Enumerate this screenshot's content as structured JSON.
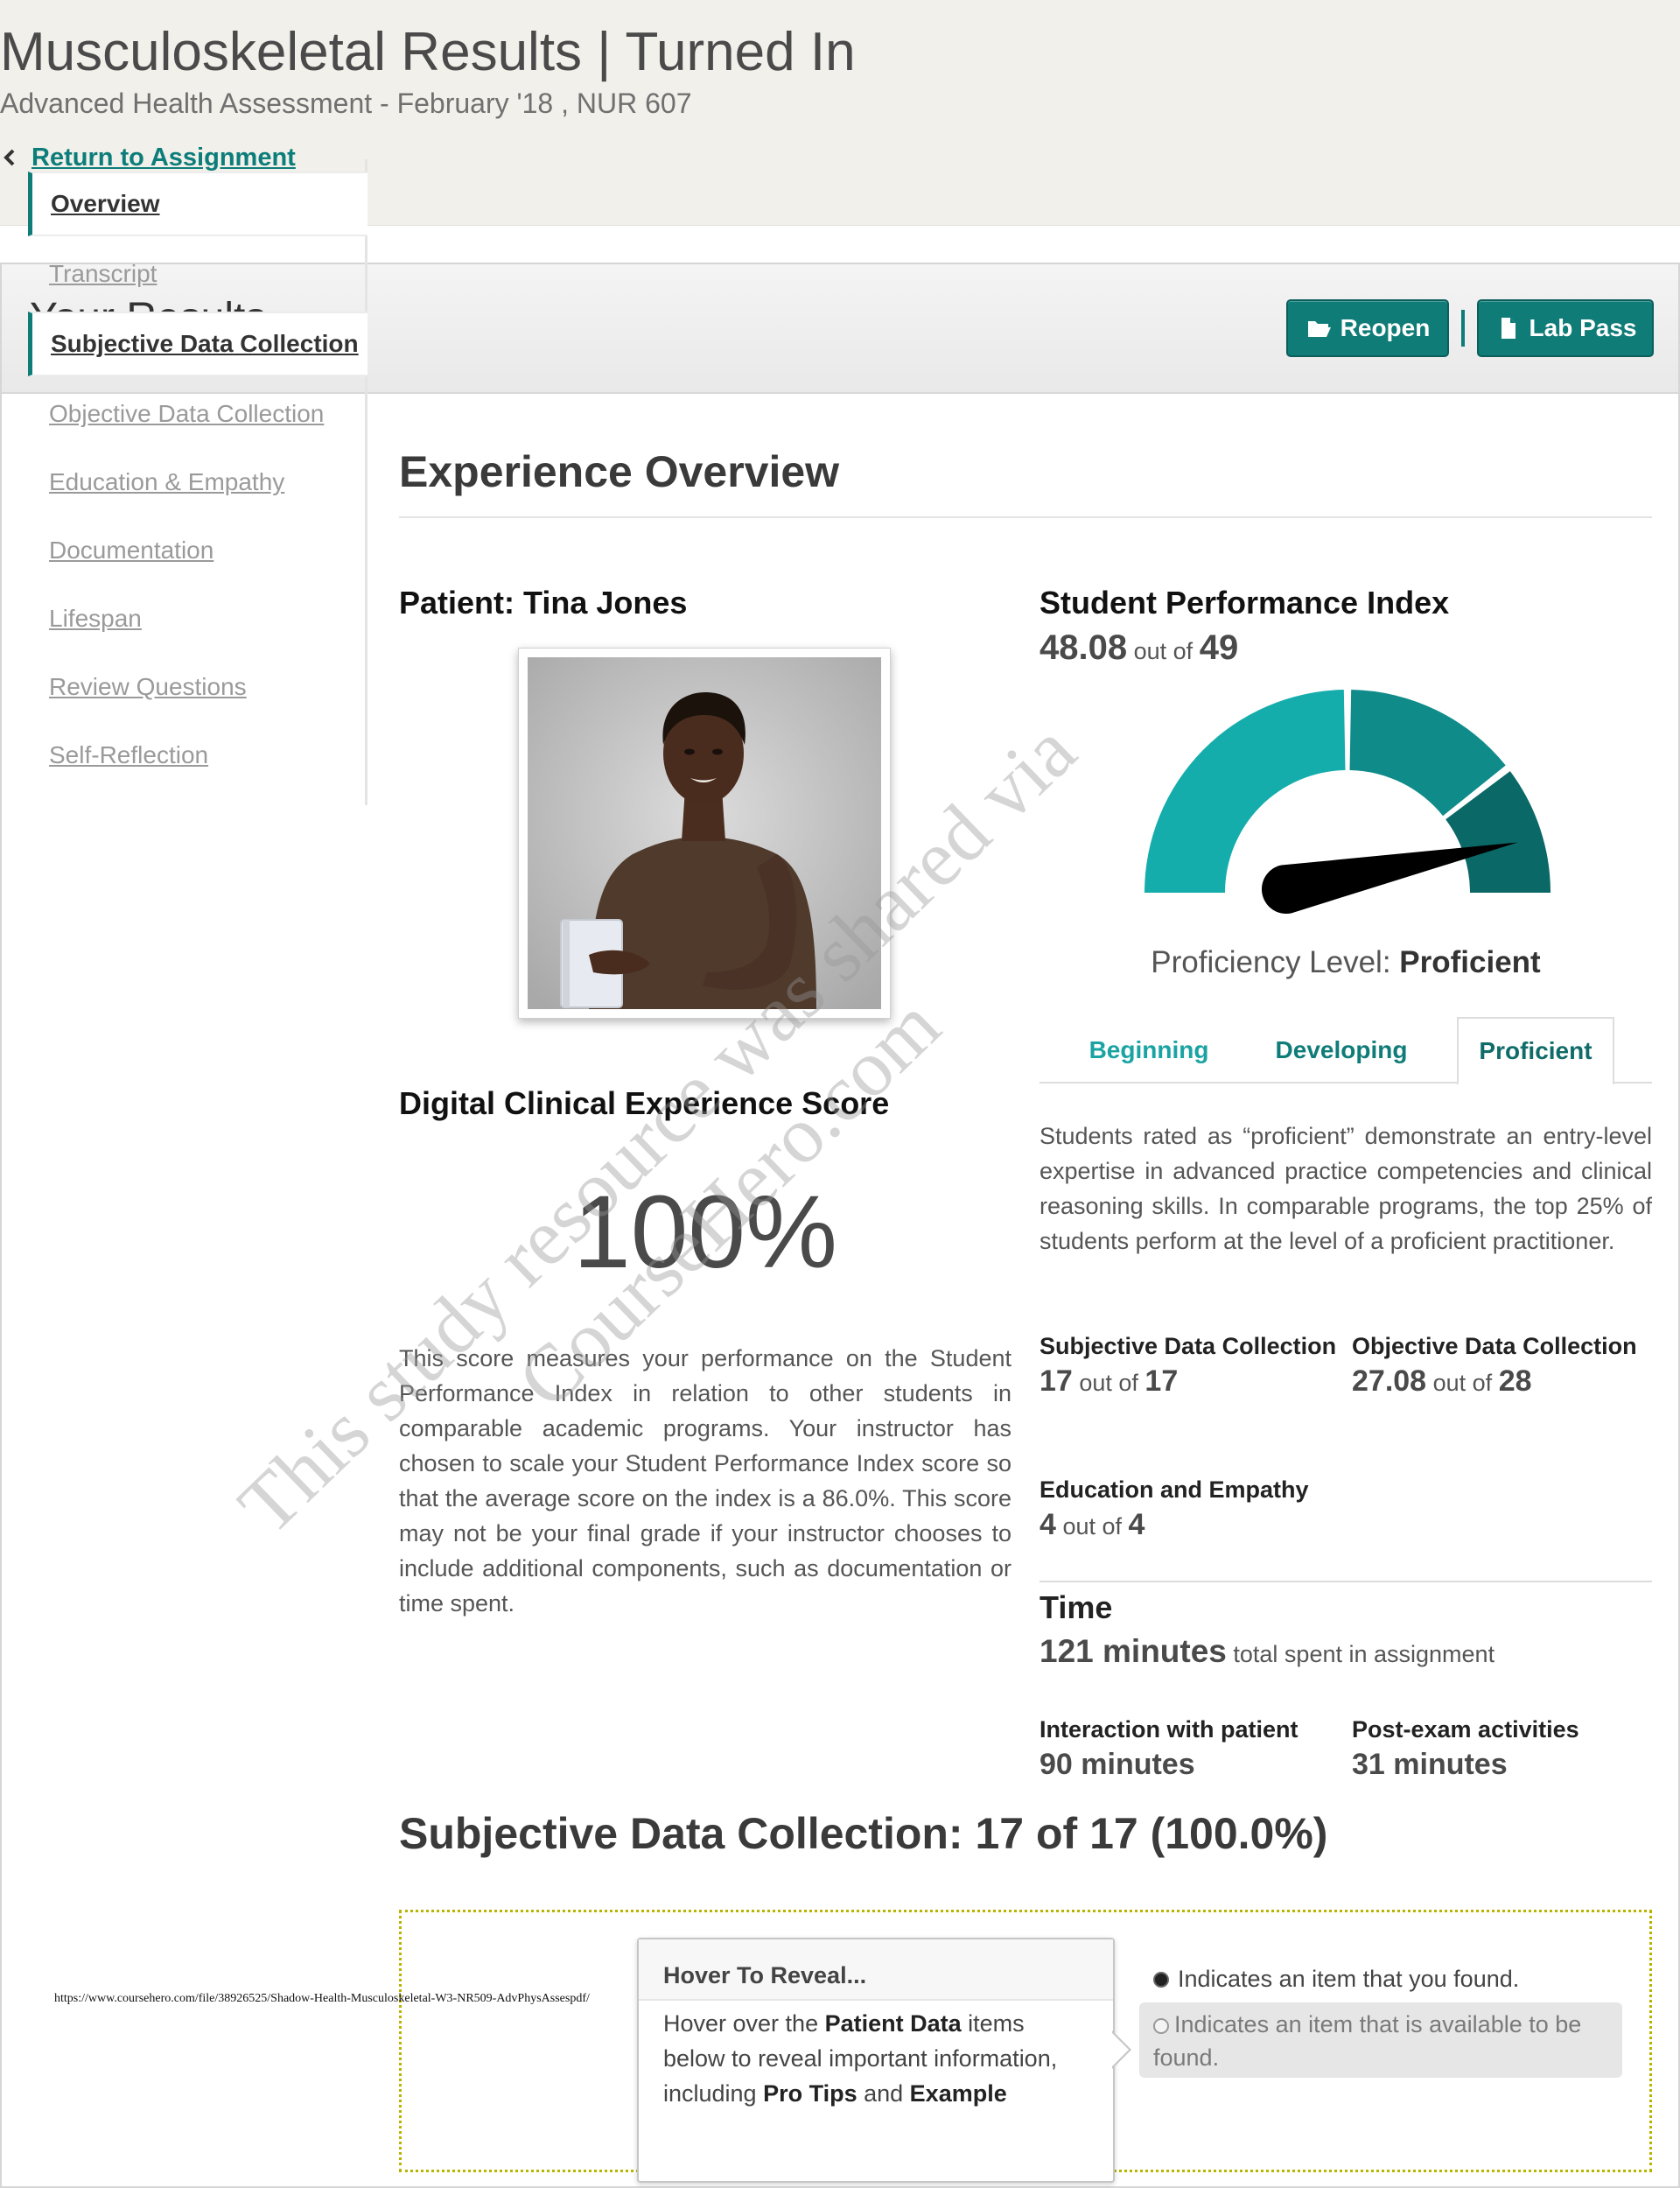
{
  "header": {
    "title": "Musculoskeletal Results | Turned In",
    "subtitle": "Advanced Health Assessment - February '18 , NUR 607",
    "return_link": "Return to Assignment"
  },
  "results": {
    "title": "Your Results",
    "reopen_label": "Reopen",
    "labpass_label": "Lab Pass"
  },
  "sidebar": {
    "items": [
      {
        "label": "Overview"
      },
      {
        "label": "Transcript"
      },
      {
        "label": "Subjective Data Collection"
      },
      {
        "label": "Objective Data Collection"
      },
      {
        "label": "Education & Empathy"
      },
      {
        "label": "Documentation"
      },
      {
        "label": "Lifespan"
      },
      {
        "label": "Review Questions"
      },
      {
        "label": "Self-Reflection"
      }
    ]
  },
  "overview": {
    "heading": "Experience Overview",
    "patient_label": "Patient: Tina Jones",
    "score_title": "Digital Clinical Experience Score",
    "score_value": "100%",
    "score_description": "This score measures your performance on the Student Performance Index in relation to other students in comparable academic programs. Your instructor has chosen to scale your Student Performance Index score so that the average score on the index is a 86.0%. This score may not be your final grade if your instructor chooses to include additional components, such as documentation or time spent."
  },
  "spi": {
    "title": "Student Performance Index",
    "score": "48.08",
    "out_of_text": "out of",
    "max": "49",
    "proficiency_label": "Proficiency Level:",
    "proficiency_value": "Proficient",
    "gauge_value_fraction": 0.981,
    "gauge_colors": [
      "#14adac",
      "#0f8b89",
      "#0a6866"
    ],
    "tabs": [
      "Beginning",
      "Developing",
      "Proficient"
    ],
    "proficient_description": "Students rated as “proficient” demonstrate an entry-level expertise in advanced practice competencies and clinical reasoning skills. In comparable programs, the top 25% of students perform at the level of a proficient practitioner."
  },
  "stats": {
    "out_of_text": "out of",
    "subjective": {
      "label": "Subjective Data Collection",
      "value": "17",
      "max": "17"
    },
    "objective": {
      "label": "Objective Data Collection",
      "value": "27.08",
      "max": "28"
    },
    "education": {
      "label": "Education and Empathy",
      "value": "4",
      "max": "4"
    }
  },
  "time": {
    "title": "Time",
    "total": "121 minutes",
    "total_suffix": "total spent in assignment",
    "interaction_label": "Interaction with patient",
    "interaction_value": "90 minutes",
    "post_label": "Post-exam activities",
    "post_value": "31 minutes"
  },
  "subjective_section": {
    "heading": "Subjective Data Collection: 17 of 17 (100.0%)",
    "hover_title": "Hover To Reveal...",
    "hover_text_1": "Hover over the ",
    "hover_bold_1": "Patient Data",
    "hover_text_2": " items below to reveal important information, including ",
    "hover_bold_2": "Pro Tips",
    "hover_text_3": " and ",
    "hover_bold_3": "Example",
    "legend_found": "Indicates an item that you found.",
    "legend_available": "Indicates an item that is available to be found."
  },
  "overlay": {
    "watermark_line1": "This study resource was shared via",
    "watermark_line2": "CourseHero.com",
    "url": "https://www.coursehero.com/file/38926525/Shadow-Health-Musculoskeletal-W3-NR509-AdvPhysAssespdf/"
  }
}
